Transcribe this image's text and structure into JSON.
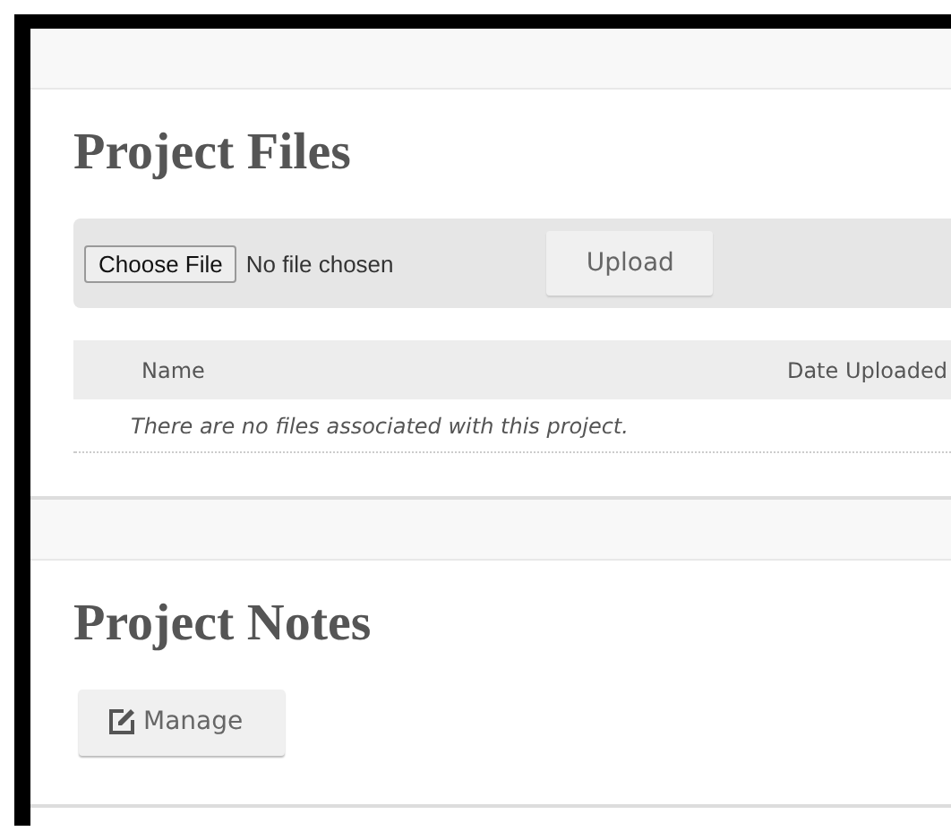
{
  "files_section": {
    "title": "Project Files",
    "file_input": {
      "button": "Choose File",
      "status": "No file chosen"
    },
    "upload_button": "Upload",
    "table": {
      "columns": [
        "Name",
        "Date Uploaded"
      ],
      "empty_message": "There are no files associated with this project."
    }
  },
  "notes_section": {
    "title": "Project Notes",
    "manage_button": "Manage"
  }
}
